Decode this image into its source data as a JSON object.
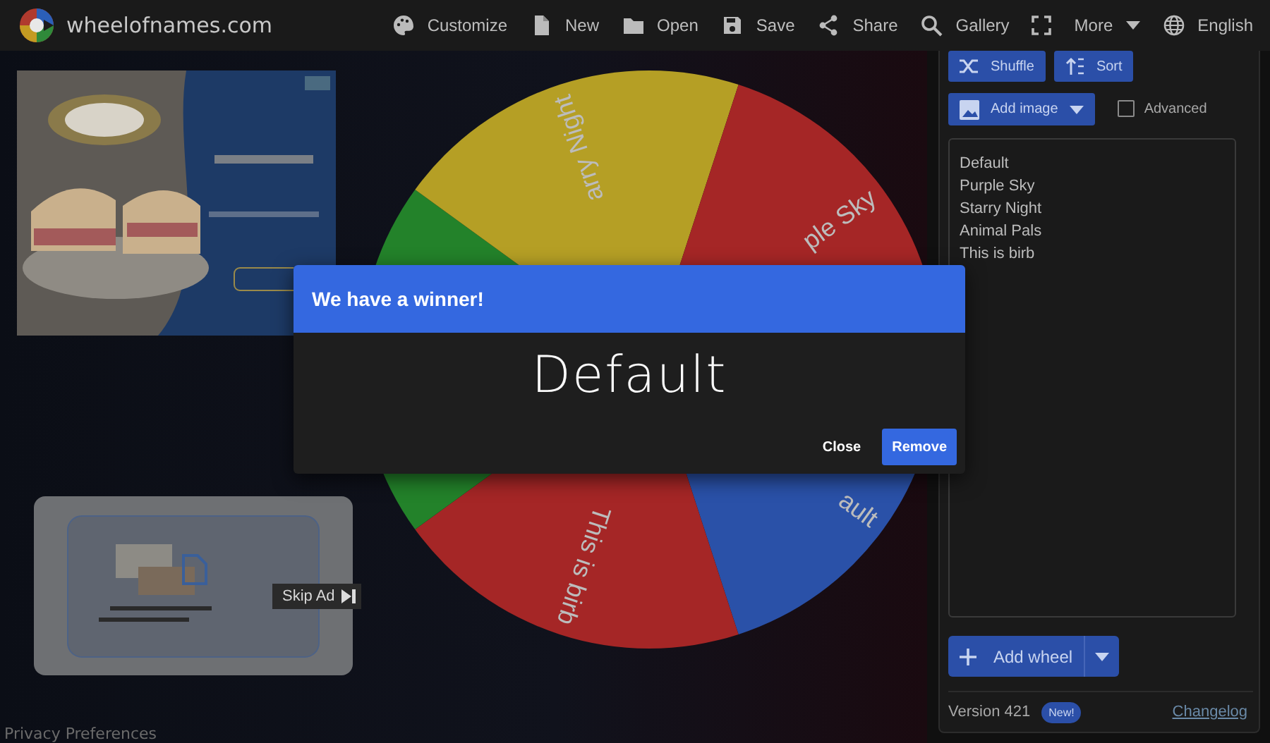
{
  "app": {
    "title": "wheelofnames.com"
  },
  "menu": [
    {
      "kind": "text",
      "label": "Customize"
    },
    {
      "kind": "text",
      "label": "New"
    },
    {
      "kind": "text",
      "label": "Open"
    },
    {
      "kind": "text",
      "label": "Save"
    },
    {
      "kind": "text",
      "label": "Share"
    },
    {
      "kind": "text",
      "label": "Gallery"
    },
    {
      "kind": "icon"
    },
    {
      "kind": "dropdown",
      "label": "More"
    },
    {
      "kind": "text",
      "label": "English"
    }
  ],
  "wheel": {
    "segments": [
      {
        "label": "ault",
        "color": "#2a51a8"
      },
      {
        "label": "This is birb",
        "color": "#a52626"
      },
      {
        "color": "#23822a"
      },
      {
        "label": "arry Night",
        "color": "#b59f25"
      },
      {
        "label": "ple Sky",
        "color": "#a52626"
      }
    ]
  },
  "ads": {
    "skip": "Skip Ad"
  },
  "privacy": "Privacy Preferences",
  "dialog": {
    "title": "We have a winner!",
    "winner": "Default",
    "buttons": [
      {
        "label": "Close",
        "kind": "text"
      },
      {
        "label": "Remove",
        "kind": "filled"
      }
    ]
  },
  "sidebar": {
    "tools": [
      {
        "label": "Shuffle"
      },
      {
        "label": "Sort"
      }
    ],
    "add_image": "Add image",
    "advanced": {
      "label": "Advanced",
      "checked": false
    },
    "entries": [
      "Default",
      "Purple Sky",
      "Starry Night",
      "Animal Pals",
      "This is birb"
    ],
    "add_wheel": "Add wheel",
    "version": "Version 421",
    "badge": "New!",
    "changelog": "Changelog"
  }
}
